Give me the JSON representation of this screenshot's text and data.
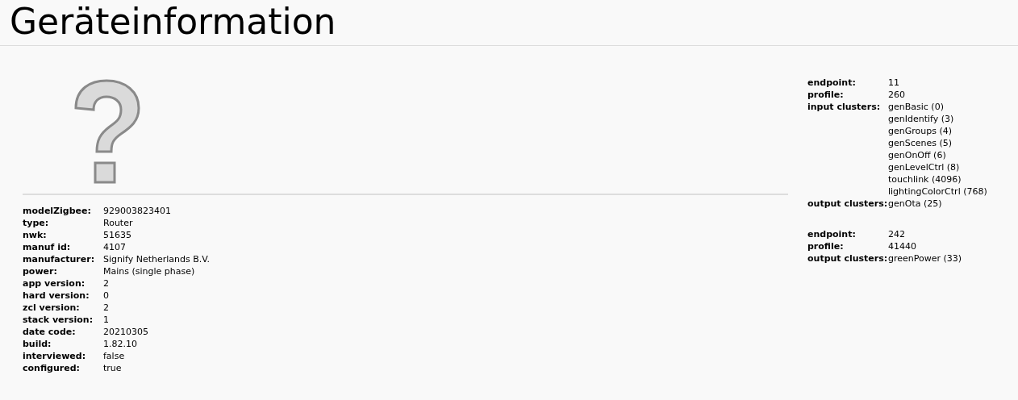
{
  "title": "Geräteinformation",
  "device_info": [
    {
      "label": "modelZigbee:",
      "value": "929003823401"
    },
    {
      "label": "type:",
      "value": "Router"
    },
    {
      "label": "nwk:",
      "value": "51635"
    },
    {
      "label": "manuf id:",
      "value": "4107"
    },
    {
      "label": "manufacturer:",
      "value": "Signify Netherlands B.V."
    },
    {
      "label": "power:",
      "value": "Mains (single phase)"
    },
    {
      "label": "app version:",
      "value": "2"
    },
    {
      "label": "hard version:",
      "value": "0"
    },
    {
      "label": "zcl version:",
      "value": "2"
    },
    {
      "label": "stack version:",
      "value": "1"
    },
    {
      "label": "date code:",
      "value": "20210305"
    },
    {
      "label": "build:",
      "value": "1.82.10"
    },
    {
      "label": "interviewed:",
      "value": "false"
    },
    {
      "label": "configured:",
      "value": "true"
    }
  ],
  "endpoints": [
    {
      "rows": [
        {
          "label": "endpoint:",
          "values": [
            "11"
          ]
        },
        {
          "label": "profile:",
          "values": [
            "260"
          ]
        },
        {
          "label": "input clusters:",
          "values": [
            "genBasic (0)",
            "genIdentify (3)",
            "genGroups (4)",
            "genScenes (5)",
            "genOnOff (6)",
            "genLevelCtrl (8)",
            "touchlink (4096)",
            "lightingColorCtrl (768)"
          ]
        },
        {
          "label": "output clusters:",
          "values": [
            "genOta (25)"
          ]
        }
      ]
    },
    {
      "rows": [
        {
          "label": "endpoint:",
          "values": [
            "242"
          ]
        },
        {
          "label": "profile:",
          "values": [
            "41440"
          ]
        },
        {
          "label": "output clusters:",
          "values": [
            "greenPower (33)"
          ]
        }
      ]
    }
  ]
}
